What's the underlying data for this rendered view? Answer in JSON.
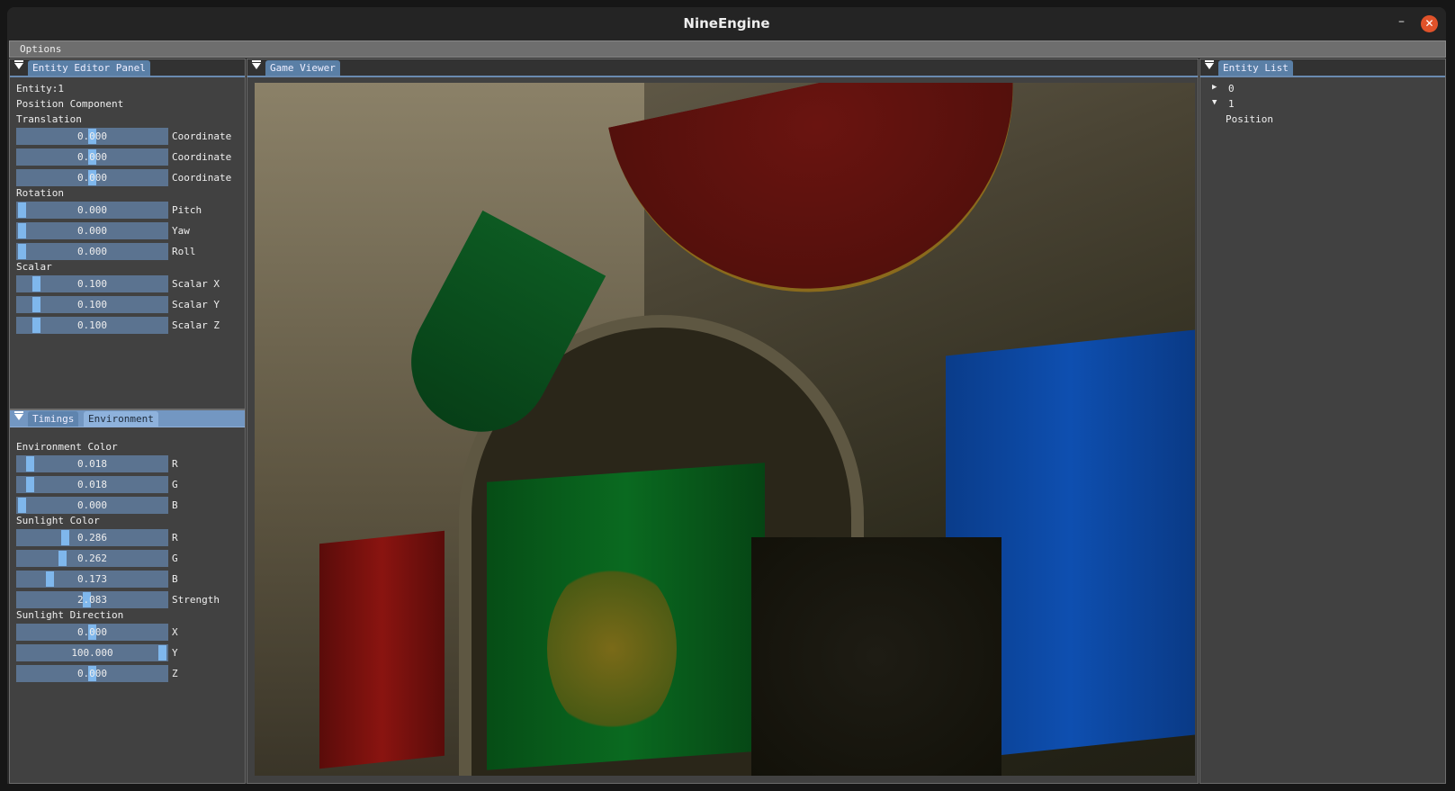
{
  "window": {
    "title": "NineEngine",
    "minimize": "–",
    "close": "✕"
  },
  "menu": {
    "options": "Options"
  },
  "entity_editor": {
    "tab": "Entity Editor Panel",
    "entity": "Entity:1",
    "component": "Position Component",
    "translation": {
      "label": "Translation",
      "sliders": [
        {
          "value": "0.000",
          "label": "Coordinate",
          "grab": 0.5
        },
        {
          "value": "0.000",
          "label": "Coordinate",
          "grab": 0.5
        },
        {
          "value": "0.000",
          "label": "Coordinate",
          "grab": 0.5
        }
      ]
    },
    "rotation": {
      "label": "Rotation",
      "sliders": [
        {
          "value": "0.000",
          "label": "Pitch",
          "grab": 0
        },
        {
          "value": "0.000",
          "label": "Yaw",
          "grab": 0
        },
        {
          "value": "0.000",
          "label": "Roll",
          "grab": 0
        }
      ]
    },
    "scalar": {
      "label": "Scalar",
      "sliders": [
        {
          "value": "0.100",
          "label": "Scalar X",
          "grab": 0.1
        },
        {
          "value": "0.100",
          "label": "Scalar Y",
          "grab": 0.1
        },
        {
          "value": "0.100",
          "label": "Scalar Z",
          "grab": 0.1
        }
      ]
    }
  },
  "environment_panel": {
    "tabs": [
      "Timings",
      "Environment"
    ],
    "env_color": {
      "label": "Environment Color",
      "sliders": [
        {
          "value": "0.018",
          "label": "R",
          "grab": 0.06
        },
        {
          "value": "0.018",
          "label": "G",
          "grab": 0.06
        },
        {
          "value": "0.000",
          "label": "B",
          "grab": 0
        }
      ]
    },
    "sun_color": {
      "label": "Sunlight Color",
      "sliders": [
        {
          "value": "0.286",
          "label": "R",
          "grab": 0.31
        },
        {
          "value": "0.262",
          "label": "G",
          "grab": 0.29
        },
        {
          "value": "0.173",
          "label": "B",
          "grab": 0.2
        },
        {
          "value": "2.083",
          "label": "Strength",
          "grab": 0.46
        }
      ]
    },
    "sun_dir": {
      "label": "Sunlight Direction",
      "sliders": [
        {
          "value": "0.000",
          "label": "X",
          "grab": 0.5
        },
        {
          "value": "100.000",
          "label": "Y",
          "grab": 1
        },
        {
          "value": "0.000",
          "label": "Z",
          "grab": 0.5
        }
      ]
    }
  },
  "game_viewer": {
    "tab": "Game Viewer"
  },
  "entity_list": {
    "tab": "Entity List",
    "items": [
      {
        "label": "0",
        "expanded": false
      },
      {
        "label": "1",
        "expanded": true,
        "children": [
          "Position"
        ]
      }
    ]
  }
}
